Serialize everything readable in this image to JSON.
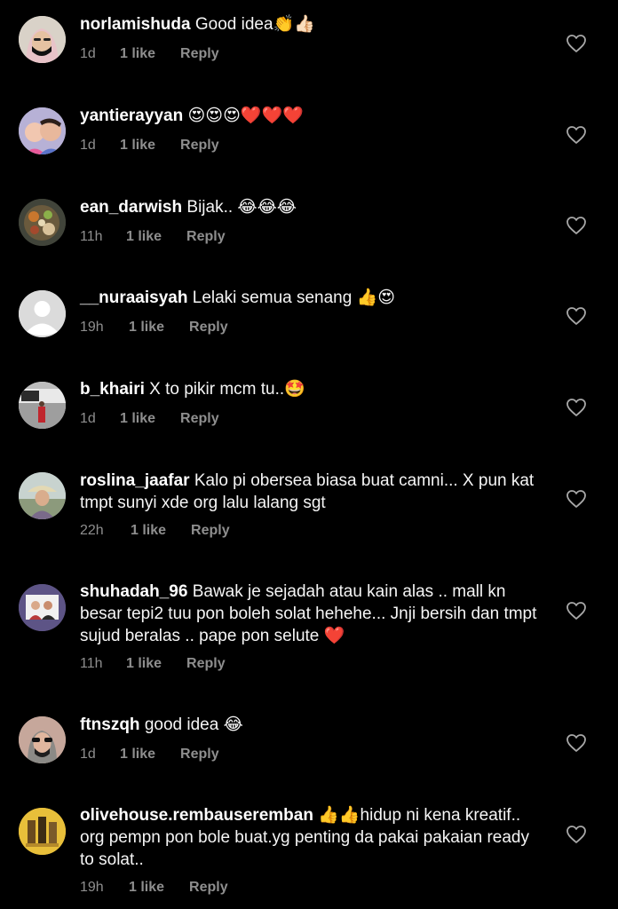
{
  "colors": {
    "background": "#000000",
    "text": "#f5f5f5",
    "muted": "#8e8e8e"
  },
  "comments": [
    {
      "username": "norlamishuda",
      "text": "Good idea👏👍🏻",
      "time": "1d",
      "likes": "1 like",
      "reply": "Reply",
      "avatar": "hijab-mask-avatar"
    },
    {
      "username": "yantierayyan",
      "text": "😍😍😍❤️❤️❤️",
      "time": "1d",
      "likes": "1 like",
      "reply": "Reply",
      "avatar": "children-photo-avatar"
    },
    {
      "username": "ean_darwish",
      "text": "Bijak.. 😂😂😂",
      "time": "11h",
      "likes": "1 like",
      "reply": "Reply",
      "avatar": "food-plate-avatar"
    },
    {
      "username": "__nuraaisyah",
      "text": "Lelaki semua senang 👍😍",
      "time": "19h",
      "likes": "1 like",
      "reply": "Reply",
      "avatar": "default-user-avatar"
    },
    {
      "username": "b_khairi",
      "text": "X to pikir mcm tu..🤩",
      "time": "1d",
      "likes": "1 like",
      "reply": "Reply",
      "avatar": "storefront-avatar"
    },
    {
      "username": "roslina_jaafar",
      "text": "Kalo pi obersea biasa buat camni... X pun kat tmpt sunyi xde org lalu lalang sgt",
      "time": "22h",
      "likes": "1 like",
      "reply": "Reply",
      "avatar": "outdoor-portrait-avatar"
    },
    {
      "username": "shuhadah_96",
      "text": "Bawak je sejadah atau kain alas .. mall kn besar tepi2 tuu pon boleh solat hehehe... Jnji bersih dan tmpt sujud beralas .. pape pon selute ❤️",
      "time": "11h",
      "likes": "1 like",
      "reply": "Reply",
      "avatar": "group-photo-avatar"
    },
    {
      "username": "ftnszqh",
      "text": "good idea 😂",
      "time": "1d",
      "likes": "1 like",
      "reply": "Reply",
      "avatar": "sunglasses-avatar"
    },
    {
      "username": "olivehouse.rembauseremban",
      "text": "👍👍hidup ni kena kreatif.. org pempn pon bole buat.yg penting da pakai pakaian ready to solat..",
      "time": "19h",
      "likes": "1 like",
      "reply": "Reply",
      "avatar": "shop-products-avatar"
    }
  ]
}
